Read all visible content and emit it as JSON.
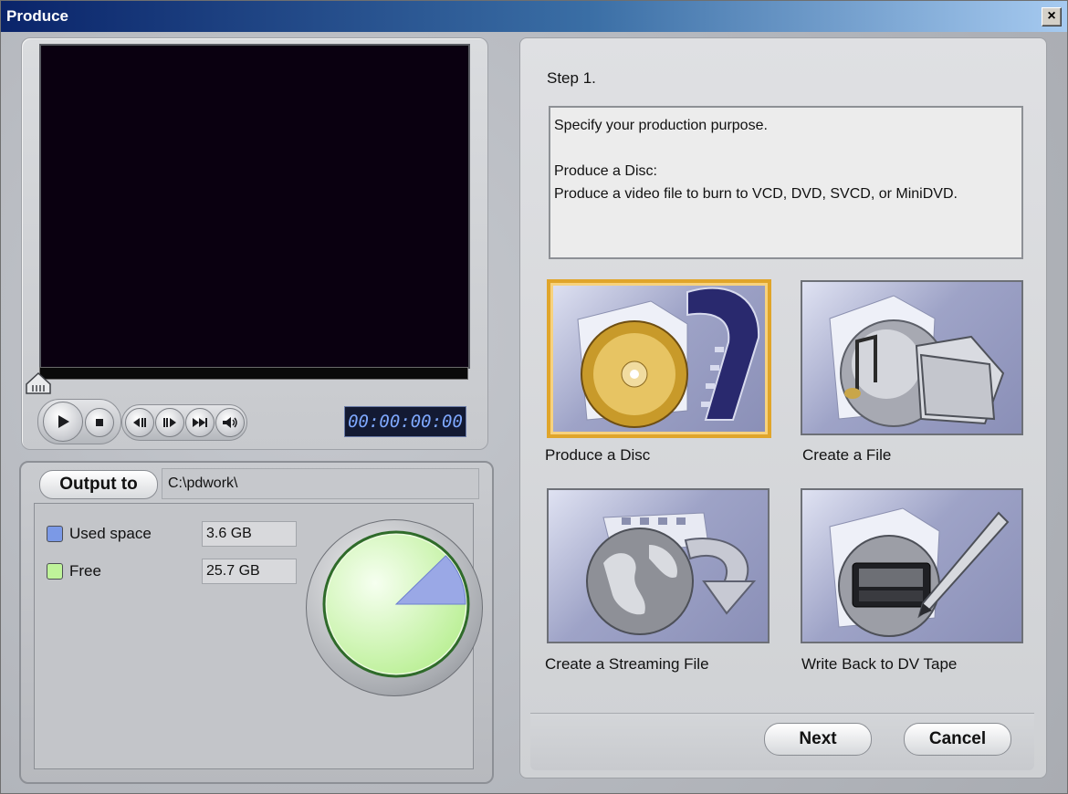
{
  "window": {
    "title": "Produce",
    "close_glyph": "×"
  },
  "player": {
    "timecode": "00:00:00:00",
    "controls": [
      "play-icon",
      "stop-icon",
      "previous-frame-icon",
      "next-frame-icon",
      "fast-forward-icon",
      "volume-icon"
    ]
  },
  "output": {
    "button_label": "Output to",
    "path": "C:\\pdwork\\",
    "used_label": "Used space",
    "used_value": "3.6  GB",
    "free_label": "Free",
    "free_value": "25.7  GB",
    "used_color": "#7b99e6",
    "free_color": "#bff39a",
    "used_fraction": 0.123
  },
  "wizard": {
    "step": "Step 1.",
    "description": {
      "line1": "Specify your production purpose.",
      "line2": "Produce a Disc:",
      "line3": "Produce a video file to burn to VCD, DVD, SVCD, or MiniDVD."
    },
    "options": [
      {
        "label": "Produce a Disc",
        "icon": "disc-icon",
        "selected": true
      },
      {
        "label": "Create a File",
        "icon": "file-icon",
        "selected": false
      },
      {
        "label": "Create a Streaming File",
        "icon": "globe-icon",
        "selected": false
      },
      {
        "label": "Write Back to DV Tape",
        "icon": "dv-tape-icon",
        "selected": false
      }
    ],
    "next_label": "Next",
    "cancel_label": "Cancel"
  }
}
